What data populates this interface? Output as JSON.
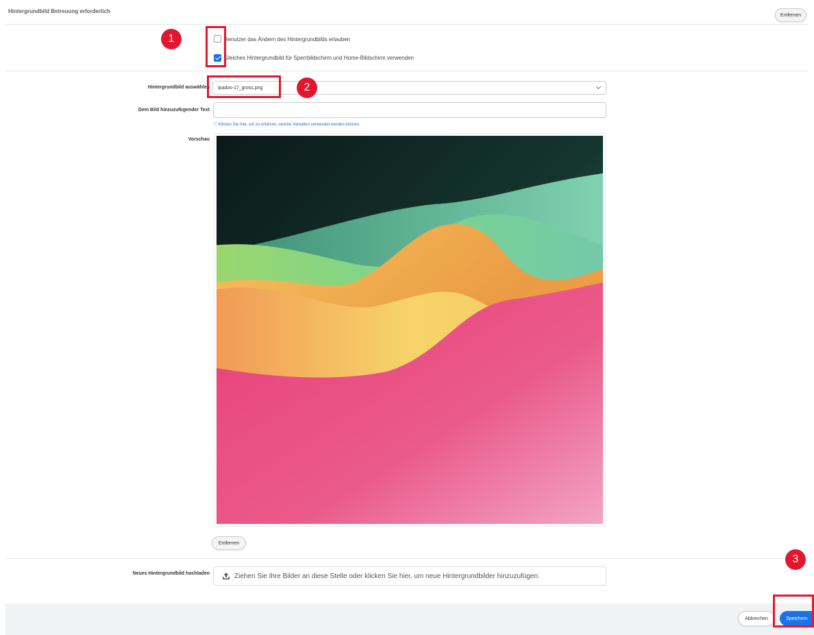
{
  "header": {
    "title": "Hintergrundbild Betreuung erforderlich",
    "remove_label": "Entfernen"
  },
  "options": {
    "allow_change_label": "Benutzer das Ändern des Hintergrundbilds erlauben",
    "allow_change_checked": false,
    "same_wallpaper_label": "Gleiches Hintergrundbild für Sperrbildschirm und Home-Bildschirm verwenden",
    "same_wallpaper_checked": true
  },
  "form": {
    "select_label": "Hintergrundbild auswählen",
    "select_value": "ipados-17_gross.png",
    "text_label": "Dem Bild hinzuzufügender Text",
    "text_value": "",
    "help_text": "ⓘ Klicken Sie hier, um zu erfahren, welche Variablen verwendet werden können.",
    "preview_label": "Vorschau",
    "preview_remove_label": "Entfernen",
    "upload_label": "Neues Hintergrundbild hochladen",
    "upload_text": "Ziehen Sie Ihre Bilder an diese Stelle oder klicken Sie hier, um neue Hintergrundbilder hinzuzufügen."
  },
  "footer": {
    "cancel_label": "Abbrechen",
    "save_label": "Speichern"
  },
  "annotations": {
    "step1": "1",
    "step2": "2",
    "step3": "3"
  },
  "colors": {
    "accent": "#1a73e8",
    "annotation": "#e2172e"
  }
}
